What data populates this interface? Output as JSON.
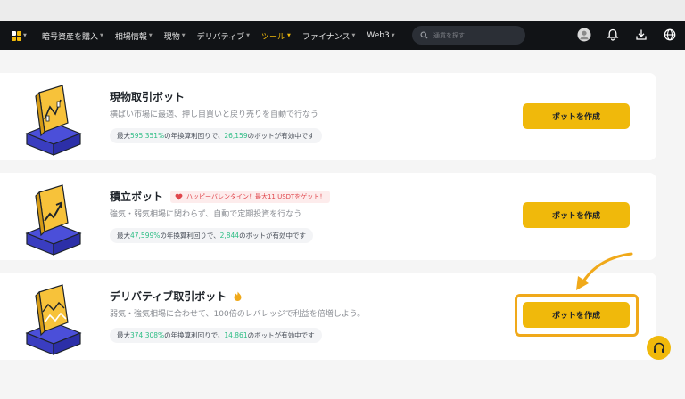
{
  "nav": {
    "items": [
      {
        "label": "暗号資産を購入"
      },
      {
        "label": "相場情報"
      },
      {
        "label": "現物"
      },
      {
        "label": "デリバティブ"
      },
      {
        "label": "ツール",
        "active": true
      },
      {
        "label": "ファイナンス"
      },
      {
        "label": "Web3"
      }
    ],
    "search_placeholder": "通貨を探す",
    "icons": [
      "avatar-icon",
      "bell-icon",
      "download-icon",
      "globe-icon"
    ]
  },
  "bots": [
    {
      "title": "現物取引ボット",
      "desc": "横ばい市場に最適、押し目買いと戻り売りを自動で行なう",
      "stat_prefix": "最大",
      "stat_apy": "595,351%",
      "stat_mid": "の年換算利回りで、",
      "stat_count": "26,159",
      "stat_suffix": "のボットが有効中です",
      "button": "ボットを作成"
    },
    {
      "title": "積立ボット",
      "promo": "ハッピーバレンタイン！最大11 USDTをゲット！",
      "desc": "強気・弱気相場に関わらず、自動で定期投資を行なう",
      "stat_prefix": "最大",
      "stat_apy": "47,599%",
      "stat_mid": "の年換算利回りで、",
      "stat_count": "2,844",
      "stat_suffix": "のボットが有効中です",
      "button": "ボットを作成"
    },
    {
      "title": "デリバティブ取引ボット",
      "desc": "弱気・強気相場に合わせて、100倍のレバレッジで利益を倍増しよう。",
      "stat_prefix": "最大",
      "stat_apy": "374,308%",
      "stat_mid": "の年換算利回りで、",
      "stat_count": "14,861",
      "stat_suffix": "のボットが有効中です",
      "button": "ボットを作成"
    }
  ],
  "colors": {
    "accent": "#f0b90b",
    "positive": "#2ebd85",
    "promo": "#e0464c",
    "highlight": "#f0a91a"
  }
}
